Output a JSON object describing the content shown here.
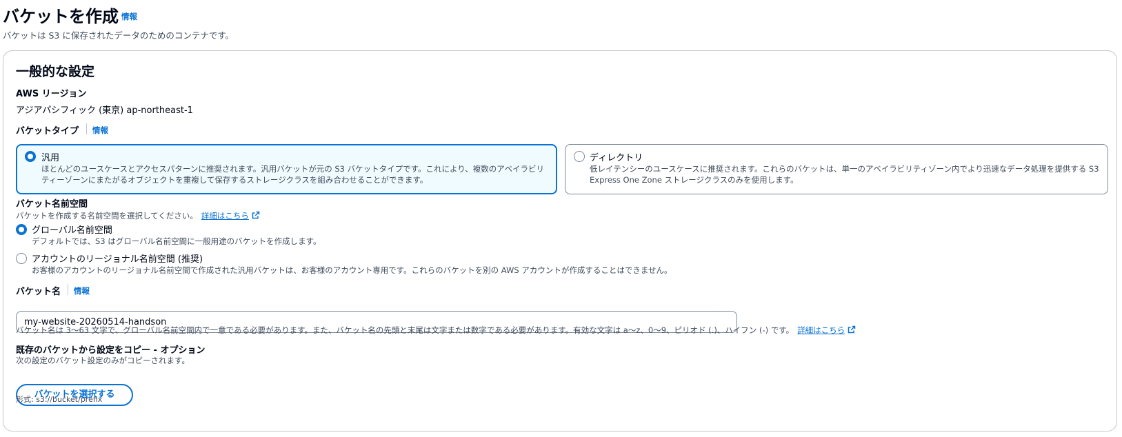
{
  "header": {
    "title": "バケットを作成",
    "info_label": "情報",
    "description": "バケットは S3 に保存されたデータのためのコンテナです。"
  },
  "general_settings": {
    "title": "一般的な設定",
    "region": {
      "label": "AWS リージョン",
      "value": "アジアパシフィック (東京) ap-northeast-1"
    },
    "bucket_type": {
      "label": "バケットタイプ",
      "info_label": "情報",
      "options": [
        {
          "title": "汎用",
          "description": "ほとんどのユースケースとアクセスパターンに推奨されます。汎用バケットが元の S3 バケットタイプです。これにより、複数のアベイラビリティーゾーンにまたがるオブジェクトを重複して保存するストレージクラスを組み合わせることができます。",
          "selected": true
        },
        {
          "title": "ディレクトリ",
          "description": "低レイテンシーのユースケースに推奨されます。これらのバケットは、単一のアベイラビリティゾーン内でより迅速なデータ処理を提供する S3 Express One Zone ストレージクラスのみを使用します。",
          "selected": false
        }
      ]
    },
    "namespace": {
      "label": "バケット名前空間",
      "description": "バケットを作成する名前空間を選択してください。",
      "learn_more": "詳細はこちら",
      "options": [
        {
          "title": "グローバル名前空間",
          "description": "デフォルトでは、S3 はグローバル名前空間に一般用途のバケットを作成します。",
          "selected": true
        },
        {
          "title": "アカウントのリージョナル名前空間 (推奨)",
          "description": "お客様のアカウントのリージョナル名前空間で作成された汎用バケットは、お客様のアカウント専用です。これらのバケットを別の AWS アカウントが作成することはできません。",
          "selected": false
        }
      ]
    },
    "bucket_name": {
      "label": "バケット名",
      "info_label": "情報",
      "value": "my-website-20260514-handson",
      "hint": "バケット名は 3〜63 文字で、グローバル名前空間内で一意である必要があります。また、バケット名の先頭と末尾は文字または数字である必要があります。有効な文字は a〜z、0〜9、ピリオド (.)、ハイフン (-) です。",
      "learn_more": "詳細はこちら"
    },
    "copy_settings": {
      "label": "既存のバケットから設定をコピー - オプション",
      "description": "次の設定のバケット設定のみがコピーされます。",
      "button_label": "バケットを選択する",
      "format_hint": "形式: s3://bucket/prefix"
    }
  },
  "colors": {
    "accent": "#0972d3",
    "selected_tile_bg": "#f0fbff",
    "text_primary": "#000716",
    "text_secondary": "#414d5c",
    "border": "#7d8998"
  },
  "icons": {
    "external_link": "external-link-icon"
  }
}
